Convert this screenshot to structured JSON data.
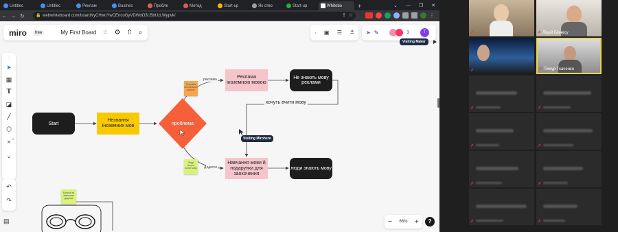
{
  "browser": {
    "tabs": [
      "Untitlec",
      "Untitlec",
      "Реклам",
      "Busines",
      "Пробле",
      "Метод",
      "Start-up",
      "Як ство",
      "Start-up",
      "Whitebo"
    ],
    "window_controls": [
      "⌄",
      "—",
      "❐",
      "✕"
    ],
    "url": "webwhiteboard.com/board/ryCHwoYwCEncoGyVDWdO3U5bUzLWypvk/",
    "extension_badge": "3"
  },
  "miro": {
    "logo": "miro",
    "plan_badge": "free",
    "board_title": "My First Board",
    "collaborator_count": "3",
    "collaborator_avatar": "T",
    "visiting_maker_label": "Visiting Maker",
    "zoom_level": "66%",
    "help_label": "?"
  },
  "flowchart": {
    "start": "Start",
    "ignorance": "Незнання іноземних мов",
    "problem": "проблема",
    "ad": "Реклама іноземною мовою",
    "dont_know": "Не знають мову реклами",
    "want_learn": "хочуть вчити мову",
    "training": "Навчання мови й подарунки для заохочення",
    "know": "люди знають мову",
    "label_ad": "реклама",
    "label_app": "Додаток",
    "sticky_1": "Реклама англійською мовою",
    "sticky_2": "Люди хочуть вчити мову",
    "sticky_3": "Бонуси за вивчення додатка",
    "visitor_cursor": "Visiting Mirohero"
  },
  "video_call": {
    "participants": [
      {
        "name": ""
      },
      {
        "name": "Ліцей Бізнесу"
      },
      {
        "name": ""
      },
      {
        "name": "Тимур Ткаченко"
      }
    ]
  },
  "colors": {
    "problem_diamond": "#f5603a",
    "sticky_orange": "#f5a64d",
    "sticky_green": "#d9f27c",
    "active_speaker_border": "#e8d84a"
  }
}
